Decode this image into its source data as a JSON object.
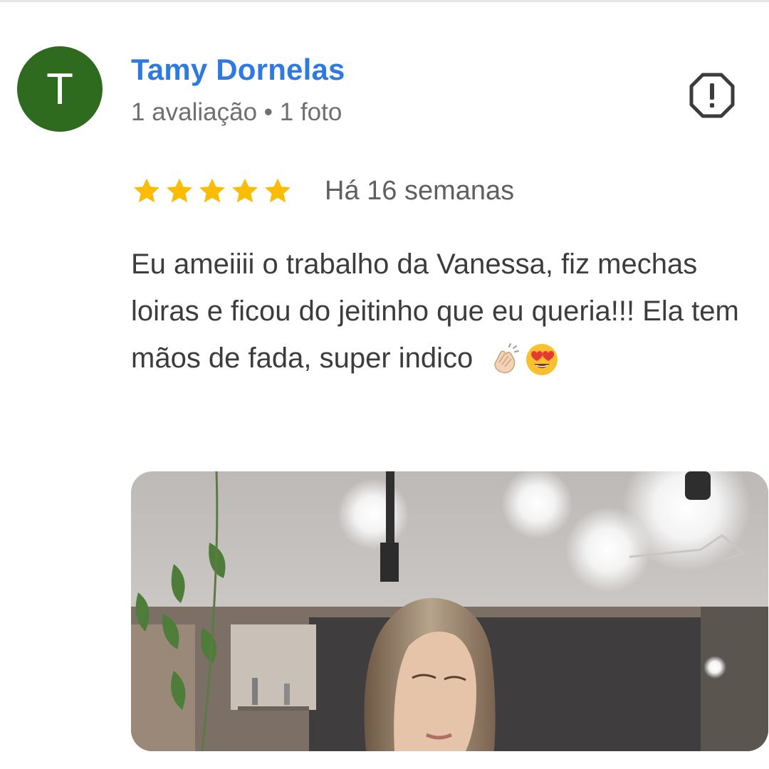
{
  "reviewer": {
    "avatar_letter": "T",
    "avatar_color": "#2e6b1f",
    "name": "Tamy Dornelas",
    "meta": "1 avaliação • 1 foto"
  },
  "report_icon": "report-octagon-icon",
  "review": {
    "rating": 5,
    "rating_max": 5,
    "time_ago": "Há 16 semanas",
    "text": "Eu ameiiii o trabalho da Vanessa, fiz mechas loiras e ficou do jeitinho que eu queria!!! Ela tem mãos de fada, super indico",
    "emojis": [
      "clapping-hands-emoji",
      "heart-eyes-emoji"
    ]
  },
  "colors": {
    "name_link": "#2f7ae0",
    "star": "#fbbc04",
    "meta_text": "#6f6f6f"
  }
}
